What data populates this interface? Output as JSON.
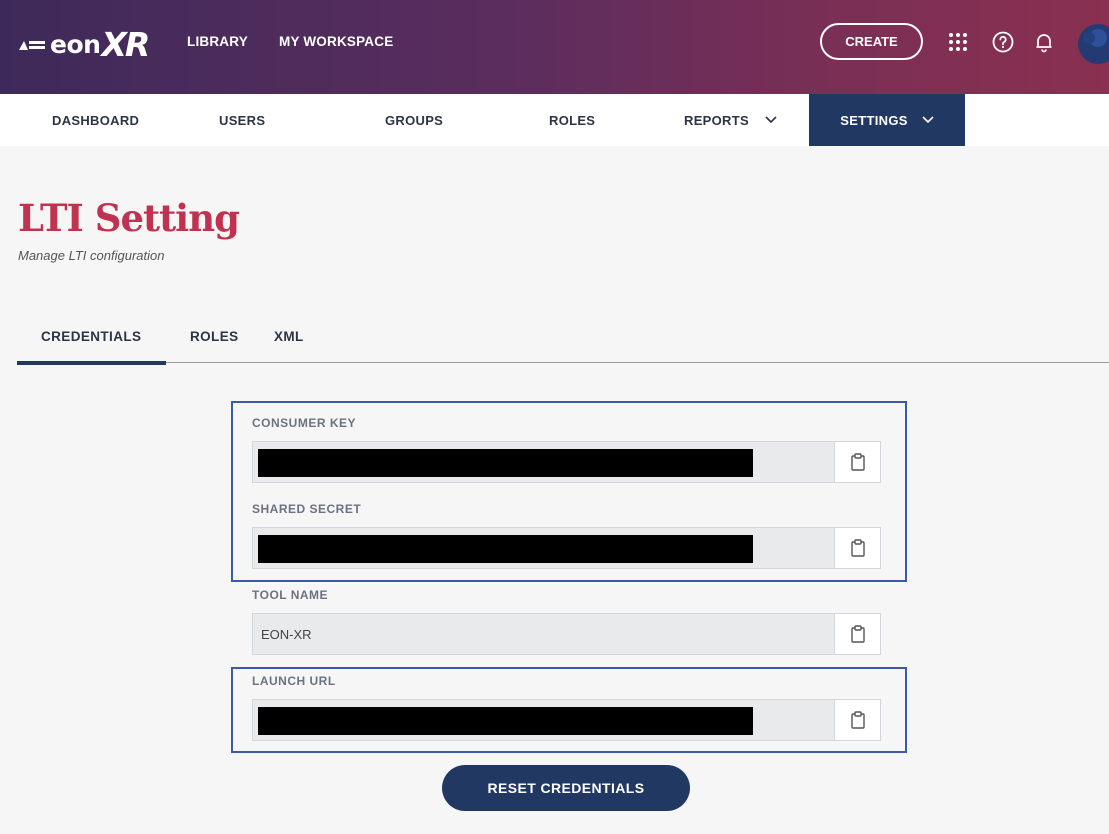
{
  "header": {
    "logo_text": "eon",
    "logo_suffix": "XR",
    "nav": [
      "LIBRARY",
      "MY WORKSPACE"
    ],
    "create_label": "CREATE",
    "icons": [
      "apps-grid-icon",
      "help-icon",
      "bell-icon",
      "user-avatar"
    ]
  },
  "subnav": {
    "items": [
      {
        "label": "DASHBOARD"
      },
      {
        "label": "USERS"
      },
      {
        "label": "GROUPS"
      },
      {
        "label": "ROLES"
      },
      {
        "label": "REPORTS",
        "dropdown": true
      },
      {
        "label": "SETTINGS",
        "dropdown": true,
        "active": true
      }
    ]
  },
  "page": {
    "title": "LTI Setting",
    "subtitle": "Manage LTI configuration"
  },
  "tabs": [
    {
      "label": "CREDENTIALS",
      "active": true
    },
    {
      "label": "ROLES"
    },
    {
      "label": "XML"
    }
  ],
  "fields": [
    {
      "label": "CONSUMER KEY",
      "value": "",
      "redacted": true
    },
    {
      "label": "SHARED SECRET",
      "value": "",
      "redacted": true
    },
    {
      "label": "TOOL NAME",
      "value": "EON-XR",
      "redacted": false
    },
    {
      "label": "LAUNCH URL",
      "value": "",
      "redacted": true
    }
  ],
  "reset_label": "RESET CREDENTIALS",
  "colors": {
    "accent": "#c0324f",
    "navy": "#213862",
    "highlight": "#3b5aa8"
  }
}
